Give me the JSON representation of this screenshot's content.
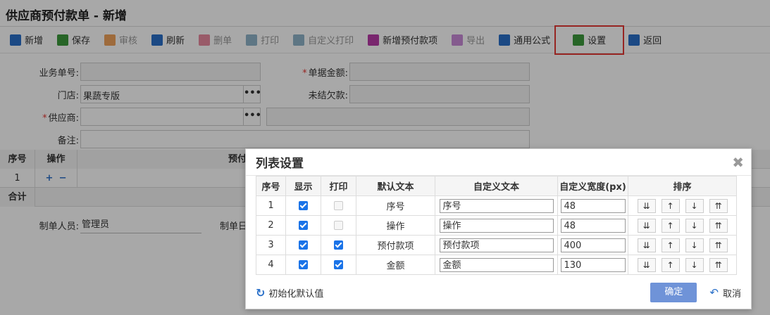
{
  "page_title": "供应商预付款单 - 新增",
  "toolbar": [
    {
      "label": "新增",
      "icon": "plus-doc-icon",
      "color": "#2a70c9",
      "disabled": false
    },
    {
      "label": "保存",
      "icon": "save-icon",
      "color": "#3c9a3c",
      "disabled": false
    },
    {
      "label": "审核",
      "icon": "check-icon",
      "color": "#f0a35c",
      "disabled": true
    },
    {
      "label": "刷新",
      "icon": "refresh-icon",
      "color": "#2a70c9",
      "disabled": false
    },
    {
      "label": "删单",
      "icon": "delete-doc-icon",
      "color": "#e88aa0",
      "disabled": true
    },
    {
      "label": "打印",
      "icon": "printer-icon",
      "color": "#8fb3c8",
      "disabled": true
    },
    {
      "label": "自定义打印",
      "icon": "printer-icon",
      "color": "#8fb3c8",
      "disabled": true
    },
    {
      "label": "新增预付款项",
      "icon": "add-item-icon",
      "color": "#b83aa8",
      "disabled": false
    },
    {
      "label": "导出",
      "icon": "export-icon",
      "color": "#c88ad8",
      "disabled": true
    },
    {
      "label": "通用公式",
      "icon": "calculator-icon",
      "color": "#2a70c9",
      "disabled": false
    },
    {
      "label": "设置",
      "icon": "edit-icon",
      "color": "#3c9a3c",
      "disabled": false
    },
    {
      "label": "返回",
      "icon": "back-arrow-icon",
      "color": "#2a70c9",
      "disabled": false
    }
  ],
  "form": {
    "business_no_label": "业务单号:",
    "amount_label": "单据金额:",
    "store_label": "门店:",
    "store_value": "果蔬专版",
    "outstanding_label": "未结欠款:",
    "supplier_label": "供应商:",
    "remark_label": "备注:"
  },
  "grid": {
    "headers": [
      "序号",
      "操作",
      "预付款项"
    ],
    "row_no": "1",
    "total_label": "合计"
  },
  "footer": {
    "creator_label": "制单人员:",
    "creator_value": "管理员",
    "date_label": "制单日"
  },
  "dialog": {
    "title": "列表设置",
    "columns": [
      "序号",
      "显示",
      "打印",
      "默认文本",
      "自定义文本",
      "自定义宽度(px)",
      "排序"
    ],
    "rows": [
      {
        "no": "1",
        "show": true,
        "print": false,
        "default_text": "序号",
        "custom_text": "序号",
        "width": "48"
      },
      {
        "no": "2",
        "show": true,
        "print": false,
        "default_text": "操作",
        "custom_text": "操作",
        "width": "48"
      },
      {
        "no": "3",
        "show": true,
        "print": true,
        "default_text": "预付款项",
        "custom_text": "预付款项",
        "width": "400"
      },
      {
        "no": "4",
        "show": true,
        "print": true,
        "default_text": "金额",
        "custom_text": "金额",
        "width": "130"
      }
    ],
    "sort_buttons": [
      "⇊",
      "↑",
      "↓",
      "⇈"
    ],
    "reset_label": "初始化默认值",
    "ok_label": "确定",
    "cancel_label": "取消"
  }
}
